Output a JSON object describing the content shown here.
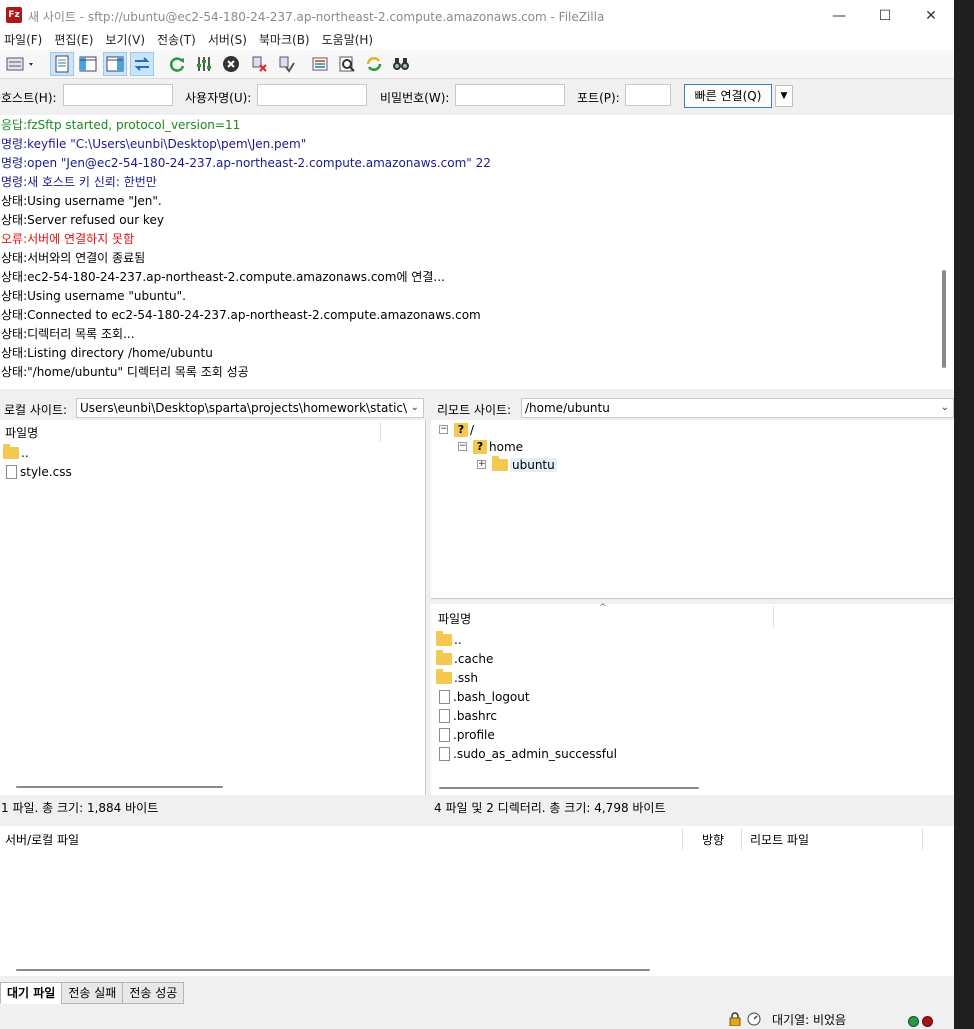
{
  "window": {
    "title": "새 사이트 - sftp://ubuntu@ec2-54-180-24-237.ap-northeast-2.compute.amazonaws.com - FileZilla",
    "app_icon": "Fz"
  },
  "menu": [
    "파일(F)",
    "편집(E)",
    "보기(V)",
    "전송(T)",
    "서버(S)",
    "북마크(B)",
    "도움말(H)"
  ],
  "quickconnect": {
    "host_label": "호스트(H):",
    "user_label": "사용자명(U):",
    "pass_label": "비밀번호(W):",
    "port_label": "포트(P):",
    "connect_label": "빠른 연결(Q)"
  },
  "log": [
    {
      "prefix": "응답:",
      "text": "fzSftp started, protocol_version=11",
      "color": "#1a8a1a"
    },
    {
      "prefix": "명령:",
      "text": "keyfile \"C:\\Users\\eunbi\\Desktop\\pem\\Jen.pem\"",
      "color": "#1a1a8c"
    },
    {
      "prefix": "명령:",
      "text": "open \"Jen@ec2-54-180-24-237.ap-northeast-2.compute.amazonaws.com\" 22",
      "color": "#1a1a8c"
    },
    {
      "prefix": "명령:",
      "text": "새 호스트 키 신뢰: 한번만",
      "color": "#1a1a8c"
    },
    {
      "prefix": "상태:",
      "text": "Using username \"Jen\".",
      "color": "#000000"
    },
    {
      "prefix": "상태:",
      "text": "Server refused our key",
      "color": "#000000"
    },
    {
      "prefix": "오류:",
      "text": "서버에 연결하지 못함",
      "color": "#e01010"
    },
    {
      "prefix": "상태:",
      "text": "서버와의 연결이 종료됨",
      "color": "#000000"
    },
    {
      "prefix": "상태:",
      "text": "ec2-54-180-24-237.ap-northeast-2.compute.amazonaws.com에 연결...",
      "color": "#000000"
    },
    {
      "prefix": "상태:",
      "text": "Using username \"ubuntu\".",
      "color": "#000000"
    },
    {
      "prefix": "상태:",
      "text": "Connected to ec2-54-180-24-237.ap-northeast-2.compute.amazonaws.com",
      "color": "#000000"
    },
    {
      "prefix": "상태:",
      "text": "디렉터리 목록 조회...",
      "color": "#000000"
    },
    {
      "prefix": "상태:",
      "text": "Listing directory /home/ubuntu",
      "color": "#000000"
    },
    {
      "prefix": "상태:",
      "text": "\"/home/ubuntu\" 디렉터리 목록 조회 성공",
      "color": "#000000"
    }
  ],
  "local": {
    "label": "로컬 사이트:",
    "path": "Users\\eunbi\\Desktop\\sparta\\projects\\homework\\static\\",
    "column": "파일명",
    "files": [
      {
        "name": "..",
        "type": "folder"
      },
      {
        "name": "style.css",
        "type": "file"
      }
    ],
    "status": "1 파일. 총 크기: 1,884 바이트"
  },
  "remote": {
    "label": "리모트 사이트:",
    "path": "/home/ubuntu",
    "tree": [
      {
        "name": "/",
        "icon": "?"
      },
      {
        "name": "home",
        "icon": "?"
      },
      {
        "name": "ubuntu",
        "icon": "folder"
      }
    ],
    "column": "파일명",
    "files": [
      {
        "name": "..",
        "type": "folder"
      },
      {
        "name": ".cache",
        "type": "folder"
      },
      {
        "name": ".ssh",
        "type": "folder"
      },
      {
        "name": ".bash_logout",
        "type": "file"
      },
      {
        "name": ".bashrc",
        "type": "file"
      },
      {
        "name": ".profile",
        "type": "file"
      },
      {
        "name": ".sudo_as_admin_successful",
        "type": "file"
      }
    ],
    "status": "4 파일 및 2 디렉터리. 총 크기: 4,798 바이트"
  },
  "queue": {
    "col_server": "서버/로컬 파일",
    "col_direction": "방향",
    "col_remote": "리모트 파일",
    "tabs": [
      "대기 파일",
      "전송 실패",
      "전송 성공"
    ]
  },
  "statusbar": {
    "queue_text": "대기열: 비었음"
  }
}
